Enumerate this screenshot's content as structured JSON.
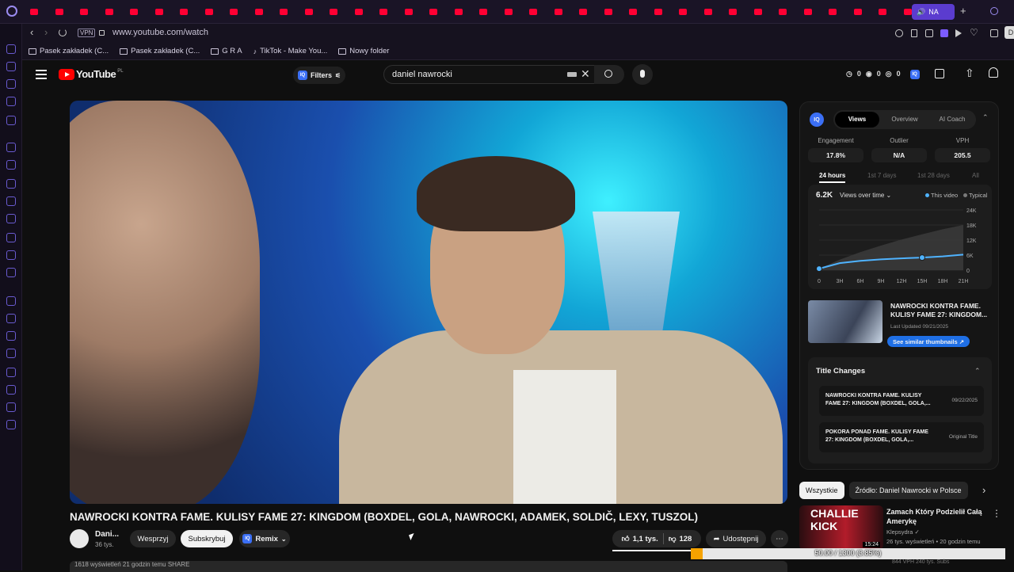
{
  "browser": {
    "active_tab_label": "NA",
    "url": "www.youtube.com/watch",
    "vpn_label": "VPN",
    "bookmarks": [
      {
        "label": "Pasek zakładek (C..."
      },
      {
        "label": "Pasek zakładek (C..."
      },
      {
        "label": "G R A"
      },
      {
        "label": "TikTok - Make You..."
      },
      {
        "label": "Nowy folder"
      }
    ]
  },
  "youtube": {
    "logo_text": "YouTube",
    "logo_country": "PL",
    "filters_label": "Filters",
    "iq_badge": "IQ",
    "search_value": "daniel nawrocki",
    "header_stats": [
      "0",
      "0",
      "0"
    ]
  },
  "video": {
    "title": "NAWROCKI KONTRA FAME. KULISY FAME 27: KINGDOM (BOXDEL, GOLA, NAWROCKI, ADAMEK, SOLDIČ, LEXY, TUSZOL)",
    "channel_name": "Dani...",
    "channel_subs": "36 tys.",
    "support_label": "Wesprzyj",
    "subscribe_label": "Subskrybuj",
    "remix_label": "Remix",
    "likes": "1,1 tys.",
    "dislikes": "128",
    "share_label": "Udostępnij",
    "description_preview": "1618 wyświetleń  21 godzin temu  SHARE"
  },
  "panel": {
    "logo": "IQ",
    "tabs": [
      {
        "label": "Views",
        "active": true
      },
      {
        "label": "Overview",
        "active": false
      },
      {
        "label": "AI Coach",
        "active": false
      }
    ],
    "metrics": [
      {
        "label": "Engagement",
        "value": "17.8%"
      },
      {
        "label": "Outlier",
        "value": "N/A"
      },
      {
        "label": "VPH",
        "value": "205.5"
      }
    ],
    "ranges": [
      {
        "label": "24 hours",
        "active": true
      },
      {
        "label": "1st 7 days",
        "active": false
      },
      {
        "label": "1st 28 days",
        "active": false
      },
      {
        "label": "All",
        "active": false
      }
    ],
    "views_value": "6.2K",
    "views_label": "Views over time",
    "legend_this": "This video",
    "legend_typical": "Typical",
    "thumb_title": "NAWROCKI KONTRA FAME. KULISY FAME 27: KINGDOM...",
    "thumb_updated": "Last Updated 09/21/2025",
    "similar_label": "See similar thumbnails ↗",
    "title_changes_heading": "Title Changes",
    "title_changes": [
      {
        "text": "NAWROCKI KONTRA FAME. KULISY FAME 27: KINGDOM (BOXDEL, GOLA,...",
        "date": "09/22/2025"
      },
      {
        "text": "POKORA PONAD FAME. KULISY FAME 27: KINGDOM (BOXDEL, GOLA,...",
        "date": "Original Title"
      }
    ]
  },
  "chart_data": {
    "type": "area",
    "x": [
      "0",
      "3H",
      "6H",
      "9H",
      "12H",
      "15H",
      "18H",
      "21H"
    ],
    "y_ticks": [
      "24K",
      "18K",
      "12K",
      "6K",
      "0"
    ],
    "ylim": [
      0,
      24000
    ],
    "series": [
      {
        "name": "This video",
        "color": "#4fb3ff",
        "values": [
          600,
          2800,
          3700,
          4300,
          4700,
          5000,
          5500,
          6200
        ]
      },
      {
        "name": "Typical",
        "color": "#7a7a7a",
        "values": [
          600,
          4200,
          7200,
          9800,
          12200,
          14300,
          16300,
          18000
        ]
      }
    ]
  },
  "chips": [
    {
      "label": "Wszystkie",
      "active": true
    },
    {
      "label": "Źródło: Daniel Nawrocki w Polsce",
      "active": false
    }
  ],
  "recommended": {
    "thumb_text": "CHALLIE KICK",
    "duration": "15:24",
    "title": "Zamach Który Podzielił Całą Amerykę",
    "channel": "Klepsydra",
    "meta": "26 tys. wyświetleń • 20 godzin temu",
    "stats_line": "844 VPH    240 tys. Subs"
  },
  "progress": {
    "text": "50.00 / 1300 (3.85%)",
    "fraction": 0.0385
  }
}
